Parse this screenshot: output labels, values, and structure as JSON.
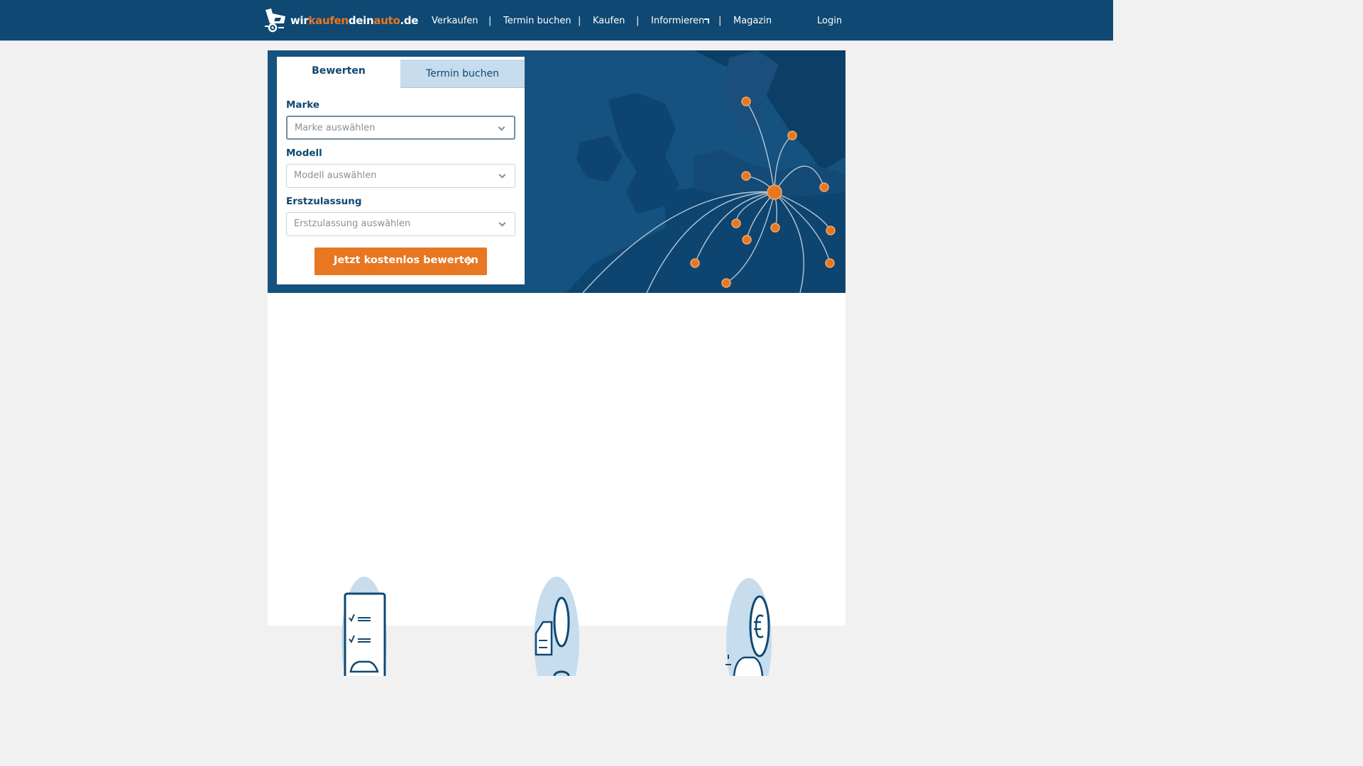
{
  "header": {
    "logo": {
      "part1": "wir",
      "part2": "kaufen",
      "part3": "dein",
      "part4": "auto",
      "part5": ".de",
      "icon": "car-trailer-logo-icon"
    },
    "nav": [
      {
        "label": "Verkaufen"
      },
      {
        "label": "Termin buchen"
      },
      {
        "label": "Kaufen"
      },
      {
        "label": "Informieren",
        "has_external_icon": true
      },
      {
        "label": "Magazin"
      }
    ],
    "separator": "|",
    "login": "Login"
  },
  "form": {
    "tabs": [
      {
        "label": "Bewerten",
        "active": true
      },
      {
        "label": "Termin buchen",
        "active": false
      }
    ],
    "fields": [
      {
        "label": "Marke",
        "placeholder": "Marke auswählen"
      },
      {
        "label": "Modell",
        "placeholder": "Modell auswählen"
      },
      {
        "label": "Erstzulassung",
        "placeholder": "Erstzulassung auswählen"
      }
    ],
    "cta": "Jetzt kostenlos bewerten"
  },
  "hero": {
    "illustration": "europe-map-network"
  },
  "steps": [
    {
      "icon": "checklist-car-icon"
    },
    {
      "icon": "car-inspection-icon"
    },
    {
      "icon": "car-euro-coin-icon"
    }
  ],
  "colors": {
    "brand": "#0f4872",
    "accent": "#e87722",
    "map": "#15527f",
    "tab_inactive": "#c7dcec"
  }
}
